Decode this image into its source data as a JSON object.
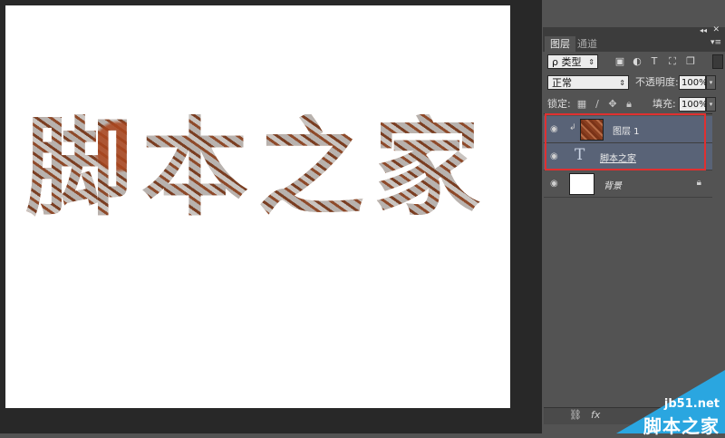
{
  "canvas": {
    "text": "脚本之家"
  },
  "panel": {
    "tabs": [
      {
        "label": "图层"
      },
      {
        "label": "通道"
      }
    ],
    "filter": {
      "label": "ρ 类型"
    },
    "blend_mode": "正常",
    "opacity_label": "不透明度:",
    "opacity_value": "100%",
    "lock_label": "锁定:",
    "fill_label": "填充:",
    "fill_value": "100%",
    "layers": [
      {
        "name": "图层 1",
        "type": "image",
        "selected": true,
        "clipped": true
      },
      {
        "name": "脚本之家",
        "type": "text",
        "selected": true
      },
      {
        "name": "背景",
        "type": "background",
        "selected": false,
        "locked": true
      }
    ]
  },
  "watermark": {
    "site": "jb51.net",
    "brand": "脚本之家"
  },
  "colors": {
    "selection": "#596377",
    "highlight": "#e03030",
    "watermark": "#2aa6e0"
  }
}
